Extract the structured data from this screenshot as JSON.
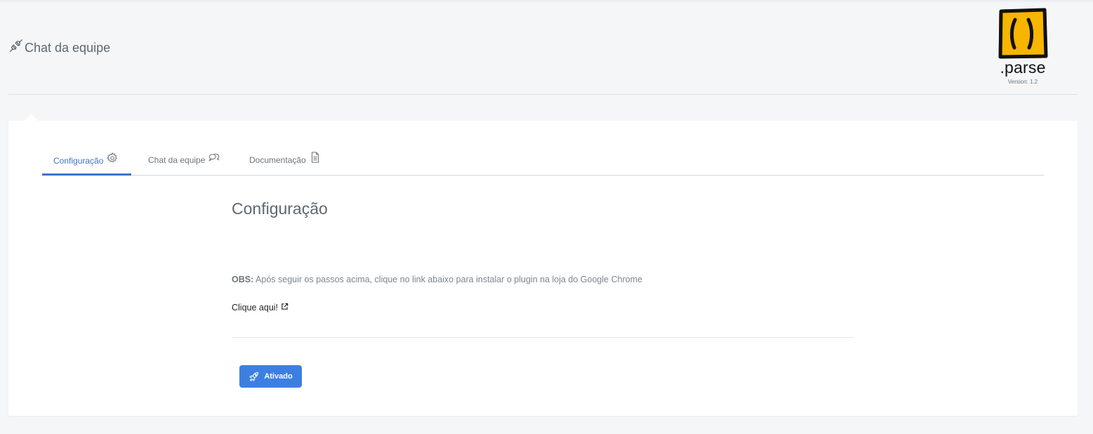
{
  "header": {
    "title": "Chat da equipe",
    "title_icon": "plug-icon",
    "brand": {
      "logo_text": ".parse",
      "version": "Version: 1.2",
      "logo_color": "#f7b500"
    }
  },
  "tabs": [
    {
      "label": "Configuração",
      "icon": "gear-icon",
      "active": true
    },
    {
      "label": "Chat da equipe",
      "icon": "chat-bubbles-icon",
      "active": false
    },
    {
      "label": "Documentação",
      "icon": "document-icon",
      "active": false
    }
  ],
  "main": {
    "section_title": "Configuração",
    "note_prefix": "OBS:",
    "note_text": " Após seguir os passos acima, clique no link abaixo para instalar o plugin na loja do Google Chrome",
    "link_text": "Clique aqui!",
    "link_icon": "external-link-icon",
    "status_button_label": "Ativado",
    "status_button_icon": "rocket-icon"
  },
  "colors": {
    "accent": "#3d74c6",
    "button": "#3d7fe0",
    "background": "#f4f6f8"
  }
}
